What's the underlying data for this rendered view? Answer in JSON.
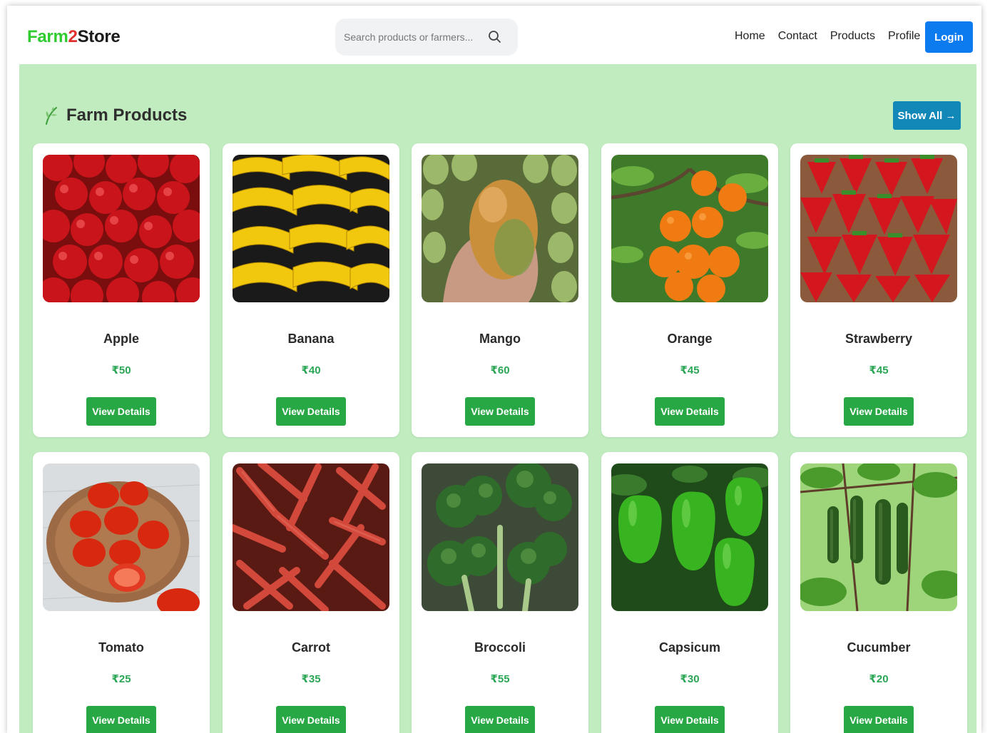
{
  "navbar": {
    "logo": {
      "part1": "Farm",
      "part2": "2",
      "part3": "Store"
    },
    "search": {
      "placeholder": "Search products or farmers..."
    },
    "links": [
      "Home",
      "Contact",
      "Products",
      "Profile"
    ],
    "login_label": "Login"
  },
  "section": {
    "title": "Farm Products",
    "show_all_label": "Show All →"
  },
  "view_details_label": "View Details",
  "products": [
    {
      "name": "Apple",
      "price": "₹50",
      "image": "apples-image"
    },
    {
      "name": "Banana",
      "price": "₹40",
      "image": "bananas-image"
    },
    {
      "name": "Mango",
      "price": "₹60",
      "image": "mango-image"
    },
    {
      "name": "Orange",
      "price": "₹45",
      "image": "oranges-image"
    },
    {
      "name": "Strawberry",
      "price": "₹45",
      "image": "strawberries-image"
    },
    {
      "name": "Tomato",
      "price": "₹25",
      "image": "tomatoes-image"
    },
    {
      "name": "Carrot",
      "price": "₹35",
      "image": "carrots-image"
    },
    {
      "name": "Broccoli",
      "price": "₹55",
      "image": "broccoli-image"
    },
    {
      "name": "Capsicum",
      "price": "₹30",
      "image": "capsicum-image"
    },
    {
      "name": "Cucumber",
      "price": "₹20",
      "image": "cucumbers-image"
    }
  ],
  "colors": {
    "accent_green": "#28a745",
    "login_blue": "#0d7bf0",
    "show_all_blue": "#1288b8",
    "section_bg": "#c1ecc0",
    "price_green": "#2aa655"
  }
}
